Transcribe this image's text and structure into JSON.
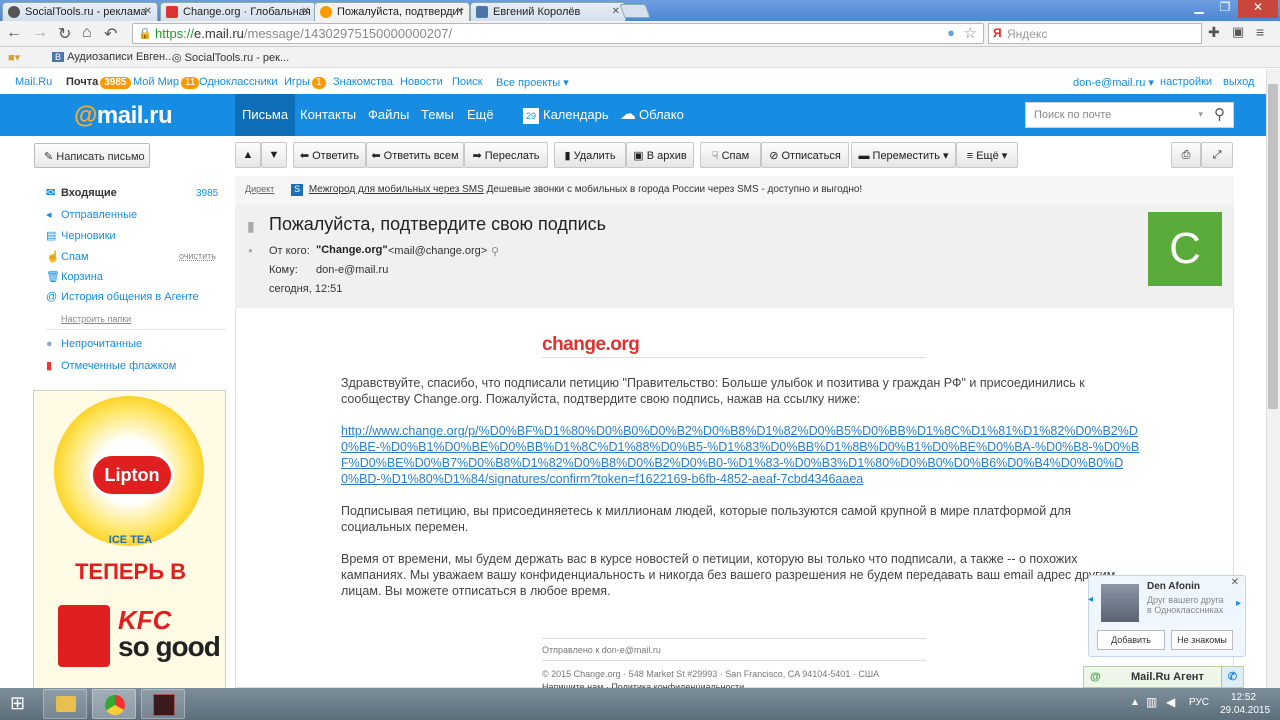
{
  "browser": {
    "tabs": [
      {
        "label": "SocialTools.ru - реклама",
        "active": false
      },
      {
        "label": "Change.org · Глобальная",
        "active": false
      },
      {
        "label": "Пожалуйста, подтвердит",
        "active": true
      },
      {
        "label": "Евгений Королёв",
        "active": false
      }
    ],
    "url_scheme": "https://",
    "url_host": "e.mail.ru",
    "url_path": "/message/14302975150000000207/",
    "search_placeholder": "Яндекс",
    "bookmarks": [
      "Аудиозаписи Евген...",
      "SocialTools.ru - рек..."
    ]
  },
  "toplinks": {
    "left": [
      "Mail.Ru",
      "Почта",
      "Мой Мир",
      "Одноклассники",
      "Игры",
      "Знакомства",
      "Новости",
      "Поиск",
      "Все проекты"
    ],
    "mail_count": "3985",
    "myworld_count": "11",
    "games_count": "1",
    "user": "don-e@mail.ru",
    "settings": "настройки",
    "logout": "выход"
  },
  "header": {
    "logo_at": "@",
    "logo_text": "mail.ru",
    "nav": [
      "Письма",
      "Контакты",
      "Файлы",
      "Темы",
      "Ещё"
    ],
    "calendar": "Календарь",
    "calendar_day": "29",
    "cloud": "Облако",
    "search_placeholder": "Поиск по почте"
  },
  "sidebar": {
    "compose": "Написать письмо",
    "folders": [
      {
        "label": "Входящие",
        "count": "3985",
        "icon": "envelope-icon"
      },
      {
        "label": "Отправленные",
        "icon": "sent-icon"
      },
      {
        "label": "Черновики",
        "icon": "draft-icon"
      },
      {
        "label": "Спам",
        "action": "очистить",
        "icon": "spam-icon"
      },
      {
        "label": "Корзина",
        "icon": "trash-icon"
      },
      {
        "label": "История общения в Агенте",
        "icon": "agent-icon"
      }
    ],
    "setup_folders": "Настроить папки",
    "filters": [
      "Непрочитанные",
      "Отмеченные флажком"
    ],
    "ad_brand": "Lipton",
    "ad_sub": "ICE TEA",
    "ad_text": "ТЕПЕРЬ В",
    "ad_brand2": "KFC",
    "ad_brand2_sub": "so good"
  },
  "toolbar": {
    "reply": "Ответить",
    "reply_all": "Ответить всем",
    "forward": "Переслать",
    "delete": "Удалить",
    "archive": "В архив",
    "spam": "Спам",
    "unsubscribe": "Отписаться",
    "move": "Переместить",
    "more": "Ещё"
  },
  "direct": {
    "label": "Директ",
    "link": "Межгород для мобильных через SMS",
    "text": "Дешевые звонки с мобильных в города России через SMS - доступно и выгодно!"
  },
  "message": {
    "subject": "Пожалуйста, подтвердите свою подпись",
    "from_label": "От кого:",
    "from_name": "\"Change.org\"",
    "from_email": "<mail@change.org>",
    "to_label": "Кому:",
    "to": "don-e@mail.ru",
    "date": "сегодня, 12:51",
    "avatar_letter": "C",
    "logo": "change.org",
    "p1": "Здравствуйте, спасибо, что подписали петицию \"Правительство: Больше улыбок и позитива у граждан РФ\" и присоединились к сообществу Change.org. Пожалуйста, подтвердите свою подпись, нажав на ссылку ниже:",
    "link": "http://www.change.org/p/%D0%BF%D1%80%D0%B0%D0%B2%D0%B8%D1%82%D0%B5%D0%BB%D1%8C%D1%81%D1%82%D0%B2%D0%BE-%D0%B1%D0%BE%D0%BB%D1%8C%D1%88%D0%B5-%D1%83%D0%BB%D1%8B%D0%B1%D0%BE%D0%BA-%D0%B8-%D0%BF%D0%BE%D0%B7%D0%B8%D1%82%D0%B8%D0%B2%D0%B0-%D1%83-%D0%B3%D1%80%D0%B0%D0%B6%D0%B4%D0%B0%D0%BD-%D1%80%D1%84/signatures/confirm?token=f1622169-b6fb-4852-aeaf-7cbd4346aaea",
    "p2": "Подписывая петицию, вы присоединяетесь к миллионам людей, которые пользуются самой крупной в мире платформой для социальных перемен.",
    "p3": "Время от времени, мы будем держать вас в курсе новостей о петиции, которую вы только что подписали, а также -- о похожих кампаниях. Мы уважаем вашу конфиденциальность и никогда без вашего разрешения не будем передавать ваш email адрес другим лицам. Вы можете отписаться в любое время.",
    "sent_to": "Отправлено к don-e@mail.ru",
    "address": "© 2015 Change.org · 548 Market St #29993 · San Francisco, CA 94104-5401 · США",
    "footer_links": "Напишите нам · Политика конфиденциальности"
  },
  "popup": {
    "name": "Den Afonin",
    "desc1": "Друг вашего друга",
    "desc2": "в Одноклассниках",
    "add": "Добавить",
    "decline": "Не знакомы"
  },
  "agent": {
    "label": "Mail.Ru Агент"
  },
  "taskbar": {
    "lang": "РУС",
    "time": "12:52",
    "date": "29.04.2015"
  }
}
